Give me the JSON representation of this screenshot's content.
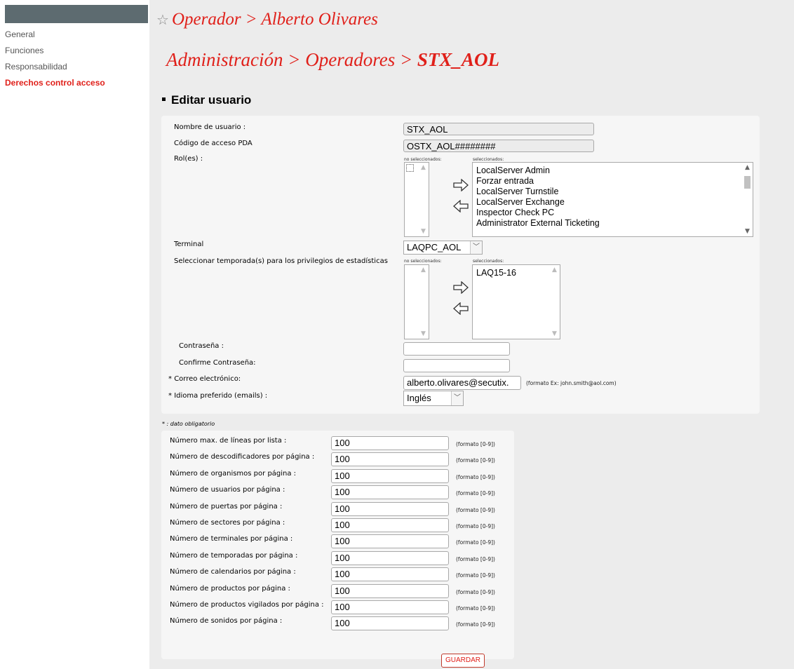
{
  "sidebar": {
    "items": [
      {
        "label": "General",
        "active": false
      },
      {
        "label": "Funciones",
        "active": false
      },
      {
        "label": "Responsabilidad",
        "active": false
      },
      {
        "label": "Derechos control acceso",
        "active": true
      }
    ]
  },
  "header": {
    "title1_prefix": "Operador > ",
    "title1_name": "Alberto Olivares",
    "breadcrumb_prefix": "Administración > Operadores > ",
    "breadcrumb_current": "STX_AOL"
  },
  "section": {
    "title": "Editar usuario"
  },
  "form": {
    "username_label": "Nombre de usuario :",
    "username_value": "STX_AOL",
    "pda_label": "Código de acceso PDA",
    "pda_value": "OSTX_AOL########",
    "roles_label": "Rol(es) :",
    "roles_unselected_label": "no seleccionados:",
    "roles_selected_label": "seleccionados:",
    "roles_selected": [
      "LocalServer Admin",
      "Forzar entrada",
      "LocalServer Turnstile",
      "LocalServer Exchange",
      "Inspector Check PC",
      "Administrator External Ticketing"
    ],
    "terminal_label": "Terminal",
    "terminal_value": "LAQPC_AOL",
    "seasons_label": "Seleccionar temporada(s) para los privilegios de estadísticas",
    "seasons_unselected_label": "no seleccionados:",
    "seasons_selected_label": "seleccionados:",
    "seasons_selected": [
      "LAQ15-16"
    ],
    "password_label": "Contraseña :",
    "password_value": "",
    "confirm_label": "Confirme Contraseña:",
    "confirm_value": "",
    "email_label": "Correo electrónico:",
    "email_value": "alberto.olivares@secutix.",
    "email_hint": "(formato  Ex: john.smith@aol.com)",
    "lang_label": "Idioma preferido (emails) :",
    "lang_value": "Inglés",
    "required_mark": "*"
  },
  "required_note": "* : dato obligatorio",
  "settings": {
    "format_hint": "(formato  [0-9])",
    "rows": [
      {
        "label": "Número max. de líneas por lista :",
        "value": "100"
      },
      {
        "label": "Número de descodificadores por página :",
        "value": "100"
      },
      {
        "label": "Número de organismos por página :",
        "value": "100"
      },
      {
        "label": "Número de usuarios por página :",
        "value": "100"
      },
      {
        "label": "Número de puertas por página :",
        "value": "100"
      },
      {
        "label": "Número de sectores por página :",
        "value": "100"
      },
      {
        "label": "Número de terminales por página :",
        "value": "100"
      },
      {
        "label": "Número de temporadas por página :",
        "value": "100"
      },
      {
        "label": "Número de calendarios por página :",
        "value": "100"
      },
      {
        "label": "Número de productos por página :",
        "value": "100"
      },
      {
        "label": "Número de productos vigilados por página :",
        "value": "100"
      },
      {
        "label": "Número de sonidos por página :",
        "value": "100"
      }
    ]
  },
  "actions": {
    "save_label": "GUARDAR"
  },
  "colors": {
    "accent": "#e0201a",
    "sidebar_head": "#5d6b70",
    "background": "#ececec"
  }
}
